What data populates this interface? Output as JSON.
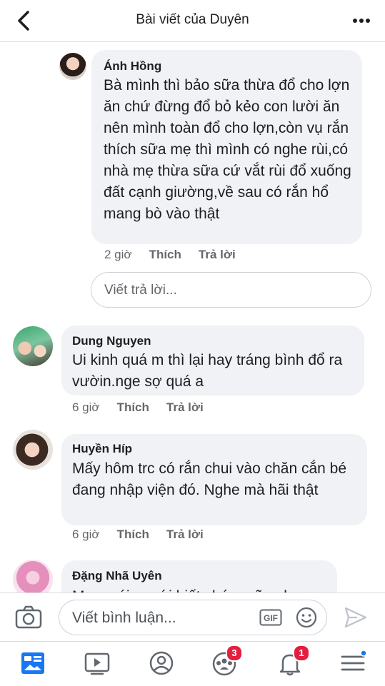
{
  "header": {
    "title": "Bài viết của Duyên"
  },
  "comments": [
    {
      "name": "Ánh Hồng",
      "text": "Bà mình thì bảo sữa thừa đổ cho lợn ăn chứ đừng đổ bỏ kẻo con lười ăn nên mình toàn đổ cho lợn,còn vụ rắn thích sữa mẹ thì mình có nghe rùi,có nhà mẹ thừa sữa cứ vắt rùi đổ xuống đất cạnh giường,về sau có rắn hổ mang bò vào thật",
      "time": "2 giờ",
      "like_label": "Thích",
      "reply_label": "Trả lời"
    },
    {
      "name": "Dung Nguyen",
      "text": "Ui kinh quá m thì lại hay tráng bình đổ ra vườin.nge sợ quá a",
      "time": "6 giờ",
      "like_label": "Thích",
      "reply_label": "Trả lời"
    },
    {
      "name": "Huyền Híp",
      "text": "Mấy hôm trc có rắn chui vào chăn cắn bé đang nhập viện đó. Nghe mà hãi thật",
      "time": "6 giờ",
      "like_label": "Thích",
      "reply_label": "Trả lời"
    },
    {
      "name": "Đặng Nhã Uyên",
      "text": "Mom nói a mới biết chứ a cũng ko"
    }
  ],
  "reply_box": {
    "placeholder": "Viết trả lời..."
  },
  "composer": {
    "placeholder": "Viết bình luận...",
    "gif_label": "GIF"
  },
  "nav": {
    "groups_badge": "3",
    "notifications_badge": "1",
    "accent": "#1877f2"
  }
}
